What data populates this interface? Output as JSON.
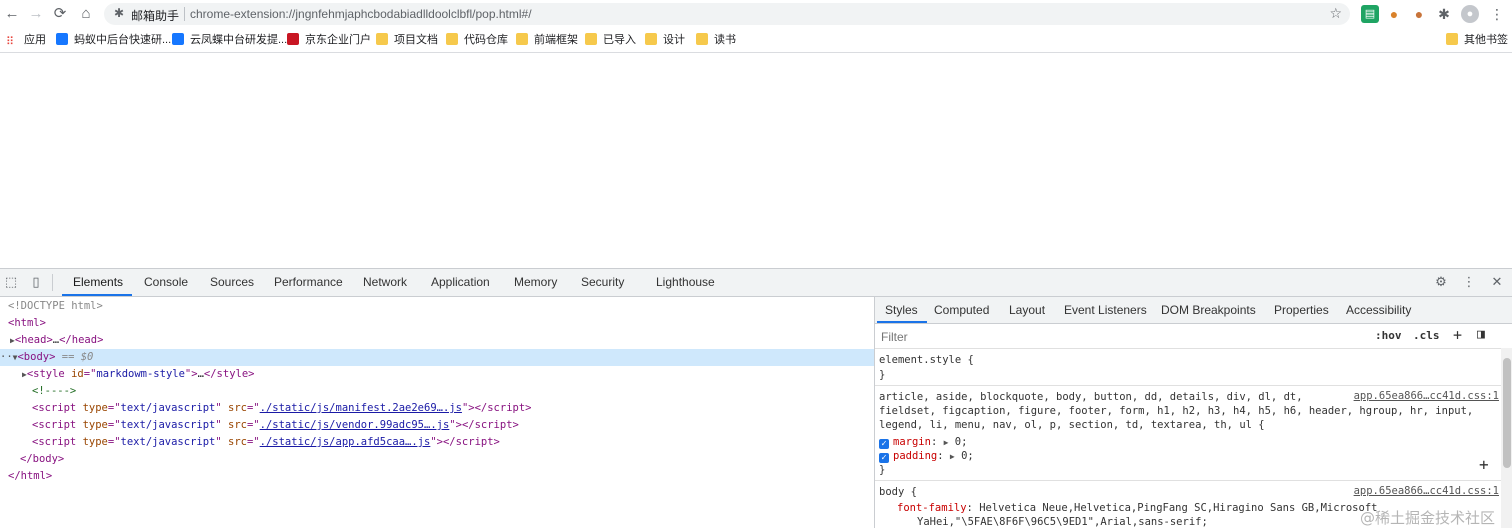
{
  "browser": {
    "extension_name": "邮箱助手",
    "url": "chrome-extension://jngnfehmjaphcbodabiadlldoolclbfl/pop.html#/"
  },
  "bookmarks": {
    "items": [
      {
        "label": "应用",
        "color": "#e8453c"
      },
      {
        "label": "蚂蚁中后台快速研...",
        "color": "#1677ff"
      },
      {
        "label": "云凤蝶中台研发提...",
        "color": "#1677ff"
      },
      {
        "label": "京东企业门户",
        "color": "#c81623"
      },
      {
        "label": "项目文档",
        "color": "#f6c94c"
      },
      {
        "label": "代码仓库",
        "color": "#f6c94c"
      },
      {
        "label": "前端框架",
        "color": "#f6c94c"
      },
      {
        "label": "已导入",
        "color": "#f6c94c"
      },
      {
        "label": "设计",
        "color": "#f6c94c"
      },
      {
        "label": "读书",
        "color": "#f6c94c"
      }
    ],
    "other": "其他书签"
  },
  "devtools": {
    "tabs": [
      "Elements",
      "Console",
      "Sources",
      "Performance",
      "Network",
      "Application",
      "Memory",
      "Security",
      "Lighthouse"
    ],
    "elements": {
      "doctype": "<!DOCTYPE html>",
      "html_open": "<html>",
      "head": "head",
      "body_marker": "== $0",
      "style_id": "markdowm-style",
      "comment": "<!---->",
      "scripts": [
        {
          "type": "text/javascript",
          "src": "./static/js/manifest.2ae2e69….js"
        },
        {
          "type": "text/javascript",
          "src": "./static/js/vendor.99adc95….js"
        },
        {
          "type": "text/javascript",
          "src": "./static/js/app.afd5caa….js"
        }
      ],
      "body_close": "</body>",
      "html_close": "</html>"
    },
    "styles": {
      "tabs": [
        "Styles",
        "Computed",
        "Layout",
        "Event Listeners",
        "DOM Breakpoints",
        "Properties",
        "Accessibility"
      ],
      "filter_placeholder": "Filter",
      "hov": ":hov",
      "cls": ".cls",
      "element_style": "element.style {",
      "close_brace": "}",
      "rule1_selector_line1": "article, aside, blockquote, body, button, dd, details, div, dl, dt,",
      "rule1_selector_line2": "fieldset, figcaption, figure, footer, form, h1, h2, h3, h4, h5, h6, header, hgroup, hr, input,",
      "rule1_selector_line3": "legend, li, menu, nav, ol, p, section, td, textarea, th, ul {",
      "rule1_source": "app.65ea866…cc41d.css:1",
      "margin_prop": "margin",
      "margin_val": "0;",
      "padding_prop": "padding",
      "padding_val": "0;",
      "rule2_selector": "body {",
      "rule2_source": "app.65ea866…cc41d.css:1",
      "font_family_prop": "font-family",
      "font_family_val1": "Helvetica Neue,Helvetica,PingFang SC,Hiragino Sans GB,Microsoft",
      "font_family_val2": "YaHei,\"\\5FAE\\8F6F\\96C5\\9ED1\",Arial,sans-serif;"
    },
    "watermark": "@稀土掘金技术社区"
  }
}
